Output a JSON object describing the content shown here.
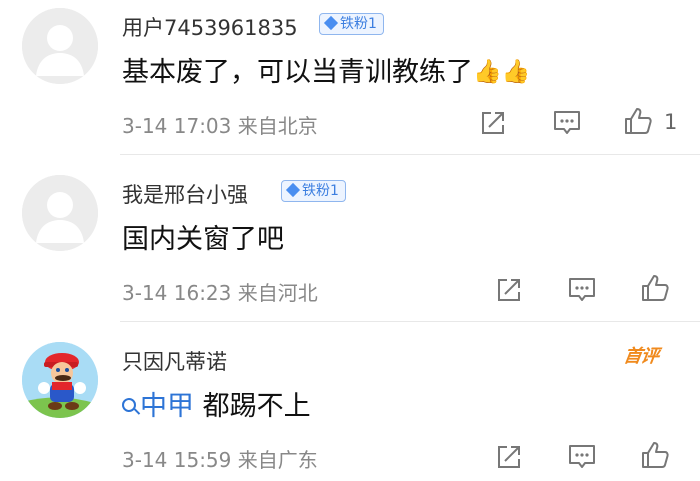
{
  "comments": [
    {
      "username": "用户7453961835",
      "badge": "铁粉1",
      "text": "基本废了，可以当青训教练了",
      "emoji": "👍👍",
      "date": "3-14 17:03",
      "location": "来自北京",
      "likes": "1"
    },
    {
      "username": "我是邢台小强",
      "badge": "铁粉1",
      "text": "国内关窗了吧",
      "date": "3-14 16:23",
      "location": "来自河北"
    },
    {
      "username": "只因凡蒂诺",
      "first_badge": "首评",
      "search_tag": "中甲",
      "text": "都踢不上",
      "date": "3-14 15:59",
      "location": "来自广东"
    }
  ],
  "icons": {
    "share": "share-icon",
    "comment": "comment-icon",
    "like": "thumbs-up-icon"
  },
  "colors": {
    "badge_blue": "#3d7fe0",
    "link_blue": "#2d74d6",
    "first_comment_orange": "#f08a1d",
    "meta_gray": "#888888"
  }
}
